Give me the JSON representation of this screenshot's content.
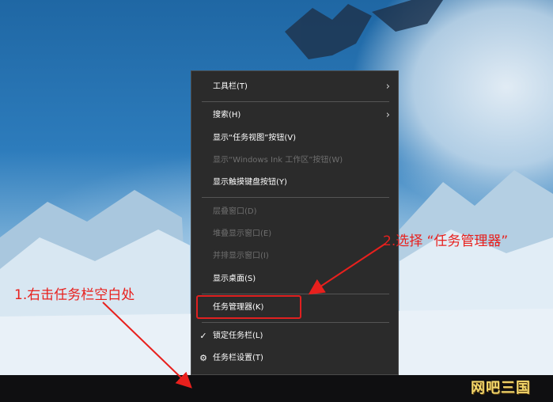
{
  "context_menu": {
    "items": [
      {
        "label": "工具栏(T)",
        "submenu": true,
        "enabled": true
      },
      {
        "label": "搜索(H)",
        "submenu": true,
        "enabled": true
      },
      {
        "label": "显示“任务视图”按钮(V)",
        "enabled": true
      },
      {
        "label": "显示“Windows Ink 工作区”按钮(W)",
        "enabled": false
      },
      {
        "label": "显示触摸键盘按钮(Y)",
        "enabled": true
      },
      {
        "label": "层叠窗口(D)",
        "enabled": false
      },
      {
        "label": "堆叠显示窗口(E)",
        "enabled": false
      },
      {
        "label": "并排显示窗口(I)",
        "enabled": false
      },
      {
        "label": "显示桌面(S)",
        "enabled": true
      },
      {
        "label": "任务管理器(K)",
        "enabled": true
      },
      {
        "label": "锁定任务栏(L)",
        "checked": true,
        "enabled": true
      },
      {
        "label": "任务栏设置(T)",
        "icon": "gear-icon",
        "enabled": true
      }
    ]
  },
  "annotations": {
    "step1": "1.右击任务栏空白处",
    "step2": "2.选择 “任务管理器”"
  },
  "watermark": "网吧三国",
  "colors": {
    "menu_bg": "#2b2b2b",
    "annotation": "#e8201d",
    "taskbar": "#0f0f11"
  }
}
